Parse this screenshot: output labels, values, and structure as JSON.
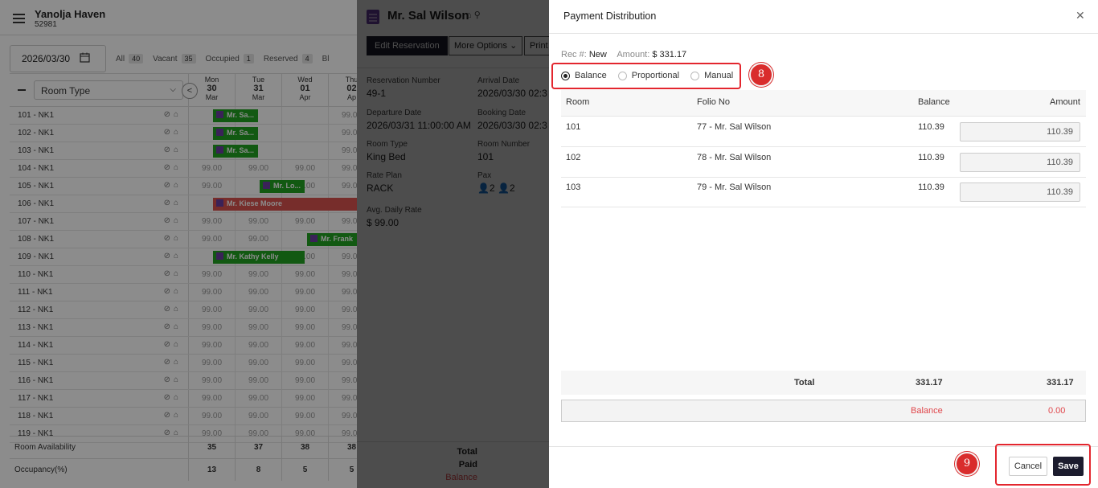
{
  "background": {
    "hotel_name": "Yanolja Haven",
    "hotel_code": "52981",
    "date": "2026/03/30",
    "filters": [
      {
        "label": "All",
        "count": "40"
      },
      {
        "label": "Vacant",
        "count": "35"
      },
      {
        "label": "Occupied",
        "count": "1"
      },
      {
        "label": "Reserved",
        "count": "4"
      },
      {
        "label": "Bl",
        "count": ""
      }
    ],
    "room_type_select": "Room Type",
    "days": [
      {
        "dow": "Mon",
        "day": "30",
        "mon": "Mar"
      },
      {
        "dow": "Tue",
        "day": "31",
        "mon": "Mar"
      },
      {
        "dow": "Wed",
        "day": "01",
        "mon": "Apr"
      },
      {
        "dow": "Thu",
        "day": "02",
        "mon": "Ap"
      }
    ],
    "rooms": [
      "101 - NK1",
      "102 - NK1",
      "103 - NK1",
      "104 - NK1",
      "105 - NK1",
      "106 - NK1",
      "107 - NK1",
      "108 - NK1",
      "109 - NK1",
      "110 - NK1",
      "111 - NK1",
      "112 - NK1",
      "113 - NK1",
      "114 - NK1",
      "115 - NK1",
      "116 - NK1",
      "117 - NK1",
      "118 - NK1",
      "119 - NK1"
    ],
    "rate": "99.00",
    "bookings": {
      "r101": "Mr. Sa...",
      "r102": "Mr. Sa...",
      "r103": "Mr. Sa...",
      "r105": "Mr. Lo...",
      "r106": "Mr. Kiese Moore",
      "r108": "Mr. Frank",
      "r109": "Mr. Kathy Kelly"
    },
    "room_availability_label": "Room Availability",
    "room_availability": [
      "35",
      "37",
      "38",
      "38"
    ],
    "occupancy_label": "Occupancy(%)",
    "occupancy": [
      "13",
      "8",
      "5",
      "5"
    ]
  },
  "reservation_panel": {
    "guest_name": "Mr. Sal Wilson",
    "edit_button": "Edit Reservation",
    "more_options_button": "More Options",
    "print_button": "Print ,",
    "fields": {
      "res_number_label": "Reservation Number",
      "res_number": "49-1",
      "arrival_label": "Arrival Date",
      "arrival": "2026/03/30 02:3",
      "departure_label": "Departure Date",
      "departure": "2026/03/31 11:00:00 AM",
      "booking_label": "Booking Date",
      "booking": "2026/03/30 02:3",
      "room_type_label": "Room Type",
      "room_type": "King Bed",
      "room_number_label": "Room Number",
      "room_number": "101",
      "rate_plan_label": "Rate Plan",
      "rate_plan": "RACK",
      "pax_label": "Pax",
      "pax_adults": "2",
      "pax_children": "2",
      "adr_label": "Avg. Daily Rate",
      "adr": "$ 99.00"
    },
    "total_label": "Total",
    "paid_label": "Paid",
    "balance_label": "Balance"
  },
  "modal": {
    "title": "Payment Distribution",
    "rec_label": "Rec #:",
    "rec_value": "New",
    "amount_label": "Amount:",
    "amount_value": "$ 331.17",
    "options": [
      "Balance",
      "Proportional",
      "Manual"
    ],
    "selected_option": "Balance",
    "columns": {
      "room": "Room",
      "folio": "Folio No",
      "balance": "Balance",
      "amount": "Amount"
    },
    "rows": [
      {
        "room": "101",
        "folio": "77 - Mr. Sal Wilson",
        "balance": "110.39",
        "amount": "110.39"
      },
      {
        "room": "102",
        "folio": "78 - Mr. Sal Wilson",
        "balance": "110.39",
        "amount": "110.39"
      },
      {
        "room": "103",
        "folio": "79 - Mr. Sal Wilson",
        "balance": "110.39",
        "amount": "110.39"
      }
    ],
    "total_label": "Total",
    "total_balance": "331.17",
    "total_amount": "331.17",
    "balance_label": "Balance",
    "balance_value": "0.00",
    "cancel_button": "Cancel",
    "save_button": "Save",
    "step_badges": [
      "8",
      "9"
    ],
    "accent_color": "#e3262e"
  }
}
